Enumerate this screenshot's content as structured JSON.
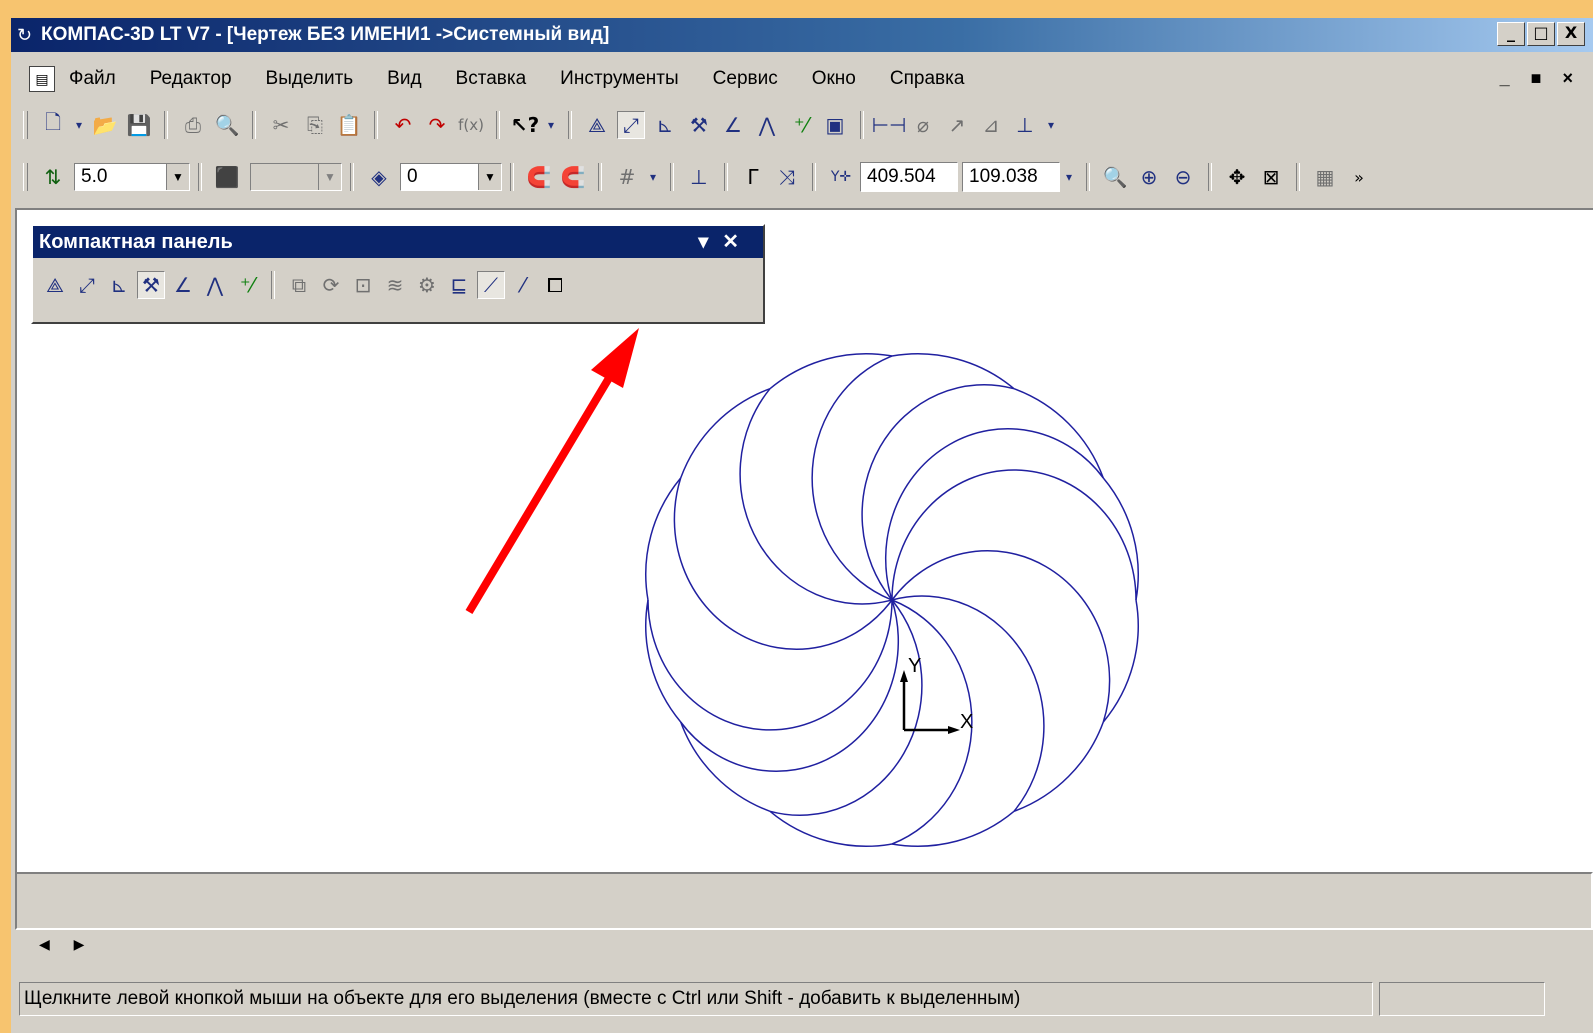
{
  "window": {
    "title": "КОМПАС-3D LT V7 - [Чертеж БЕЗ ИМЕНИ1 ->Системный вид]",
    "buttons": [
      "_",
      "□",
      "X"
    ]
  },
  "menu": {
    "items": [
      "Файл",
      "Редактор",
      "Выделить",
      "Вид",
      "Вставка",
      "Инструменты",
      "Сервис",
      "Окно",
      "Справка"
    ],
    "mdi_buttons": "_ ■ ×"
  },
  "toolbar2": {
    "step_value": "5.0",
    "layer_value": "0",
    "coord_x": "409.504",
    "coord_y": "109.038"
  },
  "compact_panel": {
    "title": "Компактная панель"
  },
  "drawing": {
    "line_color": "#2020a0",
    "axis_x_label": "X",
    "axis_y_label": "Y"
  },
  "arrow": {
    "color": "#ff0000"
  },
  "status": {
    "text": "Щелкните левой кнопкой мыши на объекте для его выделения (вместе с Ctrl или Shift - добавить к выделенным)"
  }
}
